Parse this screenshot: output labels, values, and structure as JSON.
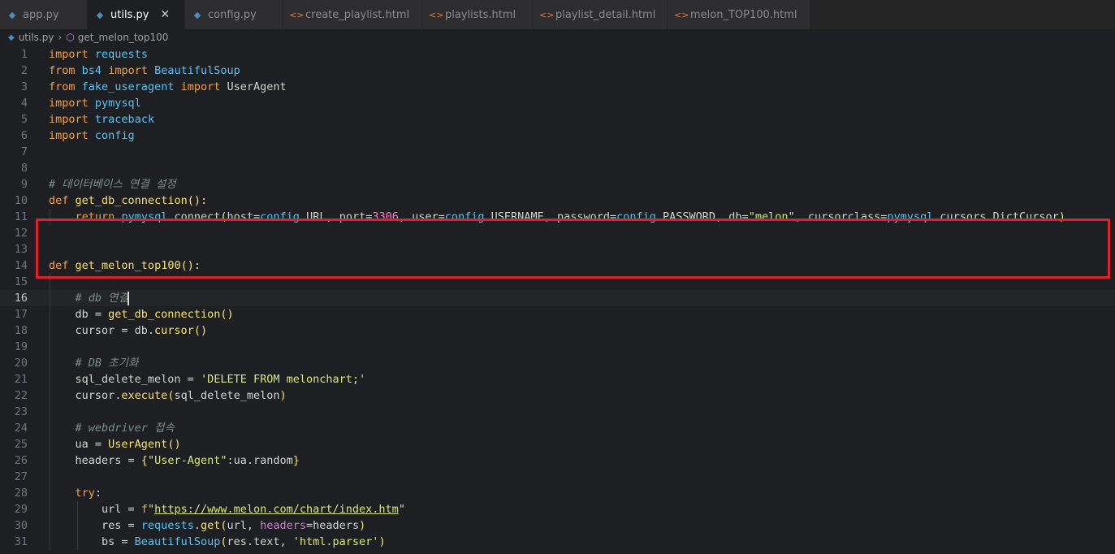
{
  "tabs": [
    {
      "label": "app.py",
      "type": "py"
    },
    {
      "label": "utils.py",
      "type": "py",
      "active": true
    },
    {
      "label": "config.py",
      "type": "py"
    },
    {
      "label": "create_playlist.html",
      "type": "html"
    },
    {
      "label": "playlists.html",
      "type": "html"
    },
    {
      "label": "playlist_detail.html",
      "type": "html"
    },
    {
      "label": "melon_TOP100.html",
      "type": "html"
    }
  ],
  "close_glyph": "✕",
  "breadcrumb": {
    "file": "utils.py",
    "symbol": "get_melon_top100"
  },
  "current_line": 16,
  "lines": [
    {
      "n": 1,
      "t": [
        [
          "kw",
          "import"
        ],
        [
          "plain",
          " "
        ],
        [
          "mod",
          "requests"
        ]
      ]
    },
    {
      "n": 2,
      "t": [
        [
          "kw",
          "from"
        ],
        [
          "plain",
          " "
        ],
        [
          "mod",
          "bs4"
        ],
        [
          "plain",
          " "
        ],
        [
          "kw",
          "import"
        ],
        [
          "plain",
          " "
        ],
        [
          "mod",
          "BeautifulSoup"
        ]
      ]
    },
    {
      "n": 3,
      "t": [
        [
          "kw",
          "from"
        ],
        [
          "plain",
          " "
        ],
        [
          "mod",
          "fake_useragent"
        ],
        [
          "plain",
          " "
        ],
        [
          "kw",
          "import"
        ],
        [
          "plain",
          " UserAgent"
        ]
      ]
    },
    {
      "n": 4,
      "t": [
        [
          "kw",
          "import"
        ],
        [
          "plain",
          " "
        ],
        [
          "mod",
          "pymysql"
        ]
      ]
    },
    {
      "n": 5,
      "t": [
        [
          "kw",
          "import"
        ],
        [
          "plain",
          " "
        ],
        [
          "mod",
          "traceback"
        ]
      ]
    },
    {
      "n": 6,
      "t": [
        [
          "kw",
          "import"
        ],
        [
          "plain",
          " "
        ],
        [
          "mod",
          "config"
        ]
      ]
    },
    {
      "n": 7,
      "t": []
    },
    {
      "n": 8,
      "t": []
    },
    {
      "n": 9,
      "t": [
        [
          "cmt",
          "# 데이터베이스 연결 설정"
        ]
      ]
    },
    {
      "n": 10,
      "t": [
        [
          "kw",
          "def"
        ],
        [
          "plain",
          " "
        ],
        [
          "fn",
          "get_db_connection"
        ],
        [
          "fn",
          "():"
        ]
      ]
    },
    {
      "n": 11,
      "t": [
        [
          "plain",
          "    "
        ],
        [
          "kw",
          "return"
        ],
        [
          "plain",
          " "
        ],
        [
          "mod",
          "pymysql"
        ],
        [
          "plain",
          ".connect"
        ],
        [
          "fn",
          "("
        ],
        [
          "plain",
          "host="
        ],
        [
          "mod",
          "config"
        ],
        [
          "plain",
          ".URL, port="
        ],
        [
          "num",
          "3306"
        ],
        [
          "plain",
          ", user="
        ],
        [
          "mod",
          "config"
        ],
        [
          "plain",
          ".USERNAME, password="
        ],
        [
          "mod",
          "config"
        ],
        [
          "plain",
          ".PASSWORD, db="
        ],
        [
          "str",
          "\"melon\""
        ],
        [
          "plain",
          ", cursorclass="
        ],
        [
          "mod",
          "pymysql"
        ],
        [
          "plain",
          ".cursors.DictCursor"
        ],
        [
          "fn",
          ")"
        ]
      ]
    },
    {
      "n": 12,
      "t": []
    },
    {
      "n": 13,
      "t": []
    },
    {
      "n": 14,
      "t": [
        [
          "kw",
          "def"
        ],
        [
          "plain",
          " "
        ],
        [
          "fn",
          "get_melon_top100"
        ],
        [
          "fn",
          "():"
        ]
      ]
    },
    {
      "n": 15,
      "t": []
    },
    {
      "n": 16,
      "t": [
        [
          "plain",
          "    "
        ],
        [
          "cmt",
          "# db 연결"
        ]
      ],
      "cursor": true
    },
    {
      "n": 17,
      "t": [
        [
          "plain",
          "    db = "
        ],
        [
          "fn",
          "get_db_connection"
        ],
        [
          "fn",
          "()"
        ]
      ]
    },
    {
      "n": 18,
      "t": [
        [
          "plain",
          "    cursor = db."
        ],
        [
          "fn",
          "cursor"
        ],
        [
          "fn",
          "()"
        ]
      ]
    },
    {
      "n": 19,
      "t": []
    },
    {
      "n": 20,
      "t": [
        [
          "plain",
          "    "
        ],
        [
          "cmt",
          "# DB 초기화"
        ]
      ]
    },
    {
      "n": 21,
      "t": [
        [
          "plain",
          "    sql_delete_melon = "
        ],
        [
          "str",
          "'DELETE FROM melonchart;'"
        ]
      ]
    },
    {
      "n": 22,
      "t": [
        [
          "plain",
          "    cursor."
        ],
        [
          "fn",
          "execute"
        ],
        [
          "fn",
          "("
        ],
        [
          "plain",
          "sql_delete_melon"
        ],
        [
          "fn",
          ")"
        ]
      ]
    },
    {
      "n": 23,
      "t": []
    },
    {
      "n": 24,
      "t": [
        [
          "plain",
          "    "
        ],
        [
          "cmt",
          "# webdriver 접속"
        ]
      ]
    },
    {
      "n": 25,
      "t": [
        [
          "plain",
          "    ua = "
        ],
        [
          "fn",
          "UserAgent"
        ],
        [
          "fn",
          "()"
        ]
      ]
    },
    {
      "n": 26,
      "t": [
        [
          "plain",
          "    headers = "
        ],
        [
          "fn",
          "{"
        ],
        [
          "str",
          "\"User-Agent\""
        ],
        [
          "plain",
          ":ua.random"
        ],
        [
          "fn",
          "}"
        ]
      ]
    },
    {
      "n": 27,
      "t": []
    },
    {
      "n": 28,
      "t": [
        [
          "plain",
          "    "
        ],
        [
          "kw",
          "try"
        ],
        [
          "plain",
          ":"
        ]
      ]
    },
    {
      "n": 29,
      "t": [
        [
          "plain",
          "        url = "
        ],
        [
          "kw",
          "f"
        ],
        [
          "str",
          "\""
        ],
        [
          "url",
          "https://www.melon.com/chart/index.htm"
        ],
        [
          "str",
          "\""
        ]
      ]
    },
    {
      "n": 30,
      "t": [
        [
          "plain",
          "        res = "
        ],
        [
          "mod",
          "requests"
        ],
        [
          "plain",
          "."
        ],
        [
          "fn",
          "get"
        ],
        [
          "fn",
          "("
        ],
        [
          "plain",
          "url, "
        ],
        [
          "purple",
          "headers"
        ],
        [
          "plain",
          "=headers"
        ],
        [
          "fn",
          ")"
        ]
      ]
    },
    {
      "n": 31,
      "t": [
        [
          "plain",
          "        bs = "
        ],
        [
          "mod",
          "BeautifulSoup"
        ],
        [
          "fn",
          "("
        ],
        [
          "plain",
          "res.text, "
        ],
        [
          "str",
          "'html.parser'"
        ],
        [
          "fn",
          ")"
        ]
      ]
    }
  ]
}
